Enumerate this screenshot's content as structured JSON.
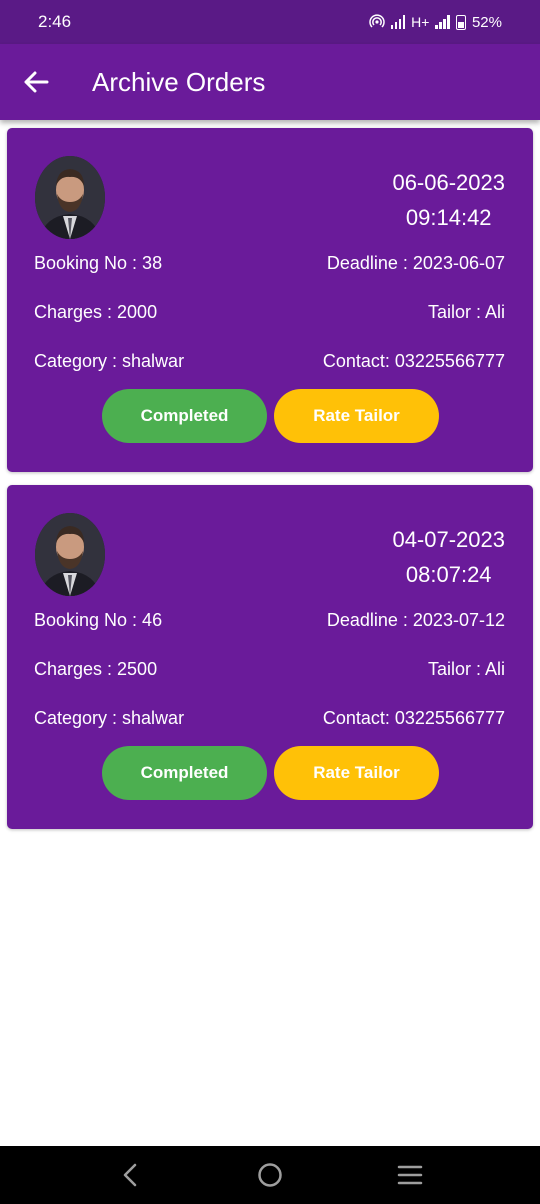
{
  "status_bar": {
    "time": "2:46",
    "network": "H+",
    "battery": "52%"
  },
  "app_bar": {
    "title": "Archive Orders"
  },
  "orders": [
    {
      "date": "06-06-2023",
      "time": "09:14:42",
      "booking": "Booking No : 38",
      "deadline": "Deadline : 2023-06-07",
      "charges": "Charges : 2000",
      "tailor": "Tailor : Ali",
      "category": "Category : shalwar",
      "contact": "Contact: 03225566777",
      "status_label": "Completed",
      "rate_label": "Rate Tailor"
    },
    {
      "date": "04-07-2023",
      "time": "08:07:24",
      "booking": "Booking No : 46",
      "deadline": "Deadline : 2023-07-12",
      "charges": "Charges : 2500",
      "tailor": "Tailor : Ali",
      "category": "Category : shalwar",
      "contact": "Contact: 03225566777",
      "status_label": "Completed",
      "rate_label": "Rate Tailor"
    }
  ],
  "icons": {
    "back": "arrow-left-icon",
    "nav_back": "chevron-left-icon",
    "nav_home": "circle-home-icon",
    "nav_menu": "hamburger-menu-icon"
  },
  "colors": {
    "primary": "#6a1b9a",
    "status_bar": "#5a1a86",
    "completed": "#4caf50",
    "rate": "#ffc107"
  }
}
